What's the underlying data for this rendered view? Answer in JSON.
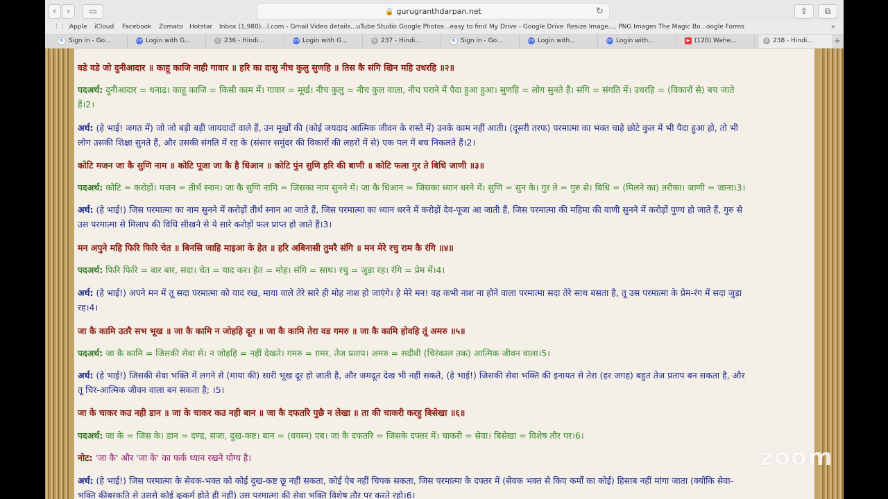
{
  "browser": {
    "url": "gurugranthdarpan.net",
    "bookmarks": [
      "Apple",
      "iCloud",
      "Facebook",
      "Zomato",
      "Hotstar",
      "Inbox (1,980)...l.com - Gmail",
      "Video details...uTube Studio",
      "Google Photos...easy to find",
      "My Drive - Google Drive",
      "Resize Image..., PNG Images",
      "The Magic Bo...oogle Forms"
    ],
    "tabs": [
      "Sign in - Go...",
      "Login with G...",
      "236 - Hindi...",
      "Login with G...",
      "237 - Hindi...",
      "Sign in - Go...",
      "Login with...",
      "Login with...",
      "(120) Wahe...",
      "238 - Hindi..."
    ]
  },
  "content": {
    "verse2": "वडे वडे जो दुनीआदार ॥ काहू काजि नाही गावार ॥ हरि का दासु नीच कुलु सुणहि ॥ तिस कै संगि खिन महि उधरहि ॥२॥",
    "pad_label": "पदअर्थ:",
    "arth_label": "अर्थ:",
    "note_label": "नोट:",
    "pad2_l1": " दुनीआदार = धनाढ। काहू काजि = किसी काम में। गावार = मूर्ख। नीच कुलु = नीच कुल वाला, नीच घराने में पैदा हुआ हुआ। सुणहि = लोग सुनते हैं। संगि = संगति में। उधरहि = (विकारों से) बच जाते",
    "pad2_l2": "हैं।2।",
    "arth2_l1": " (हे भाई! जगत में) जो जो बड़ी बड़ी जायदादों वाले हैं, उन मूर्खों की (कोई जयदाद आत्मिक जीवन के रास्ते में) उनके काम नहीं आती। (दूसरी तरफ) परमात्मा का भक्त चाहे छोटे कुल में भी पैदा हुआ हो, तो भी",
    "arth2_l2": "लोग उसकी शिक्षा सुनते हैं, और उसकी संगति में रह के (संसार समुंदर की विकारों की लहरों में से) एक पल में बच निकलते हैं।2।",
    "verse3": "कोटि मजन जा कै सुणि नाम ॥ कोटि पूजा जा कै है धिआन ॥ कोटि पुंन सुणि हरि की बाणी ॥ कोटि फला गुर ते बिधि जाणी ॥३॥",
    "pad3_l1": " कोटि = करोड़ों। मजन = तीर्थ स्नान। जा कै सुणि नामि = जिसका नाम सुनने में। जा कै धिआन = जिसका ध्यान धरने में। सुणि = सुन के। गुर ते = गुरु से। बिधि = (मिलने का) तरीका। जाणी = जाना।3।",
    "arth3_l1": " (हे भाई!) जिस परमात्मा का नाम सुनने में करोड़ों तीर्थ स्नान आ जाते हैं, जिस परमात्मा का ध्यान धरने में करोड़ों देव-पूजा आ जाती हैं, जिस परमात्मा की महिमा की वाणी सुनने में करोड़ों पुण्य हो जाते हैं, गुरु से",
    "arth3_l2": "उस परमात्मा से मिलाप की विधि सीखने से ये सारे करोड़ों फल प्राप्त हो जाते हैं।3।",
    "verse4": "मन अपुने महि फिरि फिरि चेत ॥ बिनसि जाहि माइआ के हेत ॥ हरि अबिनासी तुमरै संगि ॥ मन मेरे रचु राम कै रंगि ॥४॥",
    "pad4_l1": " फिरि फिरि = बार बार, सदा। चेत = याद कर। हेत = मोह। संगि = साथ। रचु = जुड़ा रह। रंगि = प्रेम में।4।",
    "arth4_l1": " (हे भाई!) अपने मन में तू सदा परमात्मा को याद रख, माया वाले तेरे सारे ही मोह नाश हो जाएंगे। हे मेरे मन! वह कभी नाश ना होने वाला परमात्मा सदा तेरे साथ बसता है, तू उस परमात्मा के प्रेम-रंग में सदा जुड़ा",
    "arth4_l2": "रह।4।",
    "verse5": "जा कै कामि उतरै सभ भूख ॥ जा कै कामि न जोहहि दूत ॥ जा कै कामि तेरा वड गमरु ॥ जा कै कामि होवहि तूं अमरु ॥५॥",
    "pad5_l1": " जा कै कामि = जिसकी सेवा से। न जोहहि = नहीं देखते। गमरु = ग़मर, तेज प्रताप। अमरु = सदीवी (चिरंकाल तक) आत्मिक जीवन वाला।5।",
    "arth5_l1": " (हे भाई!) जिसकी सेवा भक्ति में लगने से (माया की) सारी भूख दूर हो जाती है, और जमदूत देख भी नहीं सकते, (हे भाई!) जिसकी सेवा भक्ति की इनायत से तेरा (हर जगह) बहुत तेज प्रताप बन सकता है, और",
    "arth5_l2": "तू चिर-आत्मिक जीवन वाला बन सकता है; ।5।",
    "verse6": "जा के चाकर कउ नही डान ॥ जा के चाकर कउ नही बान ॥ जा कै दफतरि पुछै न लेखा ॥ ता की चाकरी करहु बिसेखा ॥६॥",
    "pad6_l1": " जा के = जिस के। डान = दण्ड, सजा, दुख-कष्ट। बान = (वयस्न) एब। जा कै दफतरि = जिसके दफ्तर में। चाकरी = सेवा। बिसेखा = विशेष तौर पर।6।",
    "note6": " 'जा कै' और 'जा के' का फर्क ध्यान रखने योग्य है।",
    "arth6_l1": " (हे भाई!) जिस परमात्मा के सेवक-भक्त को कोई दुख-कष्ट छू नहीं सकता, कोई ऐब नहीं चिपक सकता, जिस परमात्मा के दफ्तर में (सेवक भक्त से किए कर्मों का कोई) हिसाब नहीं मांगा जाता (क्योंकि सेवा-",
    "arth6_l2": "भक्ति कीबरकति से उससे कोई कुकर्म होते ही नहीं) उस परमात्मा की सेवा भक्ति विशेष तौर पर करते रहो।6।"
  },
  "watermark": "zoom"
}
